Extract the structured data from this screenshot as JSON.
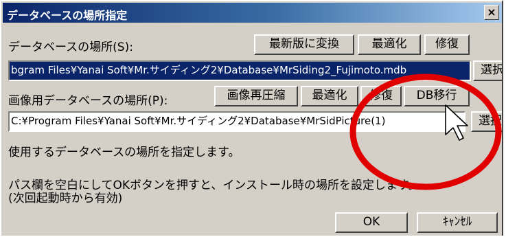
{
  "dialog": {
    "title": "データベースの場所指定",
    "close": "×"
  },
  "db": {
    "label": "データベースの場所(S):",
    "buttons": {
      "upgrade": "最新版に変換",
      "optimize": "最適化",
      "repair": "修復",
      "browse": "選択"
    },
    "path": "bgram Files¥Yanai Soft¥Mr.サイディング2¥Database¥MrSiding2_Fujimoto.mdb"
  },
  "image_db": {
    "label": "画像用データベースの場所(P):",
    "buttons": {
      "recompress": "画像再圧縮",
      "optimize": "最適化",
      "repair": "修復",
      "migrate": "DB移行",
      "browse": "選択"
    },
    "path": "C:¥Program Files¥Yanai Soft¥Mr.サイディング2¥Database¥MrSidPicture(1)"
  },
  "info": {
    "line1": "使用するデータベースの場所を指定します。",
    "line2": "パス欄を空白にしてOKボタンを押すと、インストール時の場所を設定します。",
    "line3": "(次回起動時から有効)"
  },
  "footer": {
    "ok": "OK",
    "cancel": "ｷｬﾝｾﾙ"
  },
  "colors": {
    "title_start": "#0a246a",
    "selection": "#0a246a",
    "highlight_circle": "#e00000"
  }
}
